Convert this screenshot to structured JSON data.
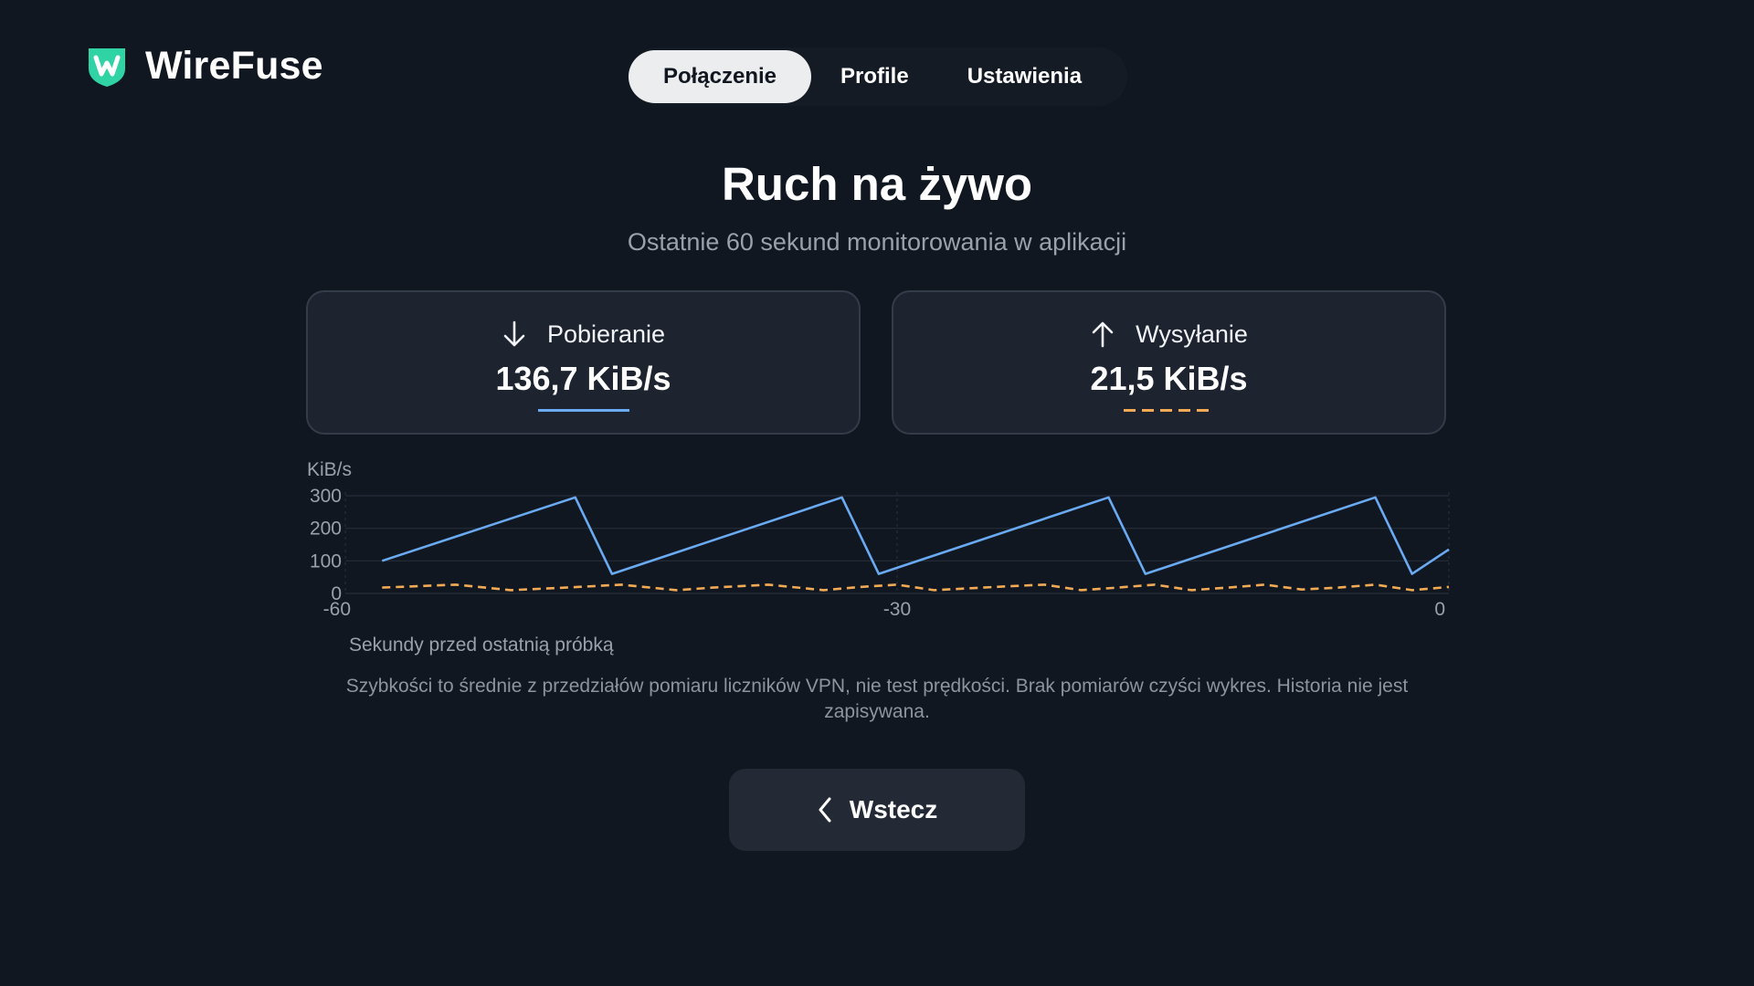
{
  "app": {
    "name": "WireFuse",
    "accent": "#2fd3a4"
  },
  "tabs": [
    {
      "label": "Połączenie",
      "active": true
    },
    {
      "label": "Profile",
      "active": false
    },
    {
      "label": "Ustawienia",
      "active": false
    }
  ],
  "page": {
    "title": "Ruch na żywo",
    "subtitle": "Ostatnie 60 sekund monitorowania w aplikacji"
  },
  "stats": {
    "download": {
      "label": "Pobieranie",
      "value": "136,7 KiB/s",
      "icon": "arrow-down-icon",
      "color": "#6aaaf2"
    },
    "upload": {
      "label": "Wysyłanie",
      "value": "21,5 KiB/s",
      "icon": "arrow-up-icon",
      "color": "#f2aa55"
    }
  },
  "chart_data": {
    "type": "line",
    "ylabel": "KiB/s",
    "xlabel": "Sekundy przed ostatnią próbką",
    "ylim": [
      0,
      300
    ],
    "xlim": [
      -60,
      0
    ],
    "y_ticks": [
      "300",
      "200",
      "100",
      "0"
    ],
    "x_ticks": [
      "-60",
      "-30",
      "0"
    ],
    "grid": true,
    "series": [
      {
        "style": "solid",
        "color": "#6aaaf2",
        "x": [
          -58,
          -47.5,
          -45.5,
          -33,
          -31,
          -18.5,
          -16.5,
          -4,
          -2,
          0
        ],
        "values": [
          100,
          295,
          60,
          295,
          60,
          295,
          60,
          295,
          60,
          135
        ]
      },
      {
        "style": "dashed",
        "color": "#f2aa55",
        "x": [
          -58,
          -54,
          -51,
          -48,
          -45,
          -42,
          -40,
          -37,
          -34,
          -32,
          -30,
          -28,
          -26,
          -24,
          -22,
          -20,
          -18,
          -16,
          -14,
          -12,
          -10,
          -8,
          -6,
          -4,
          -2,
          0
        ],
        "values": [
          18,
          27,
          10,
          18,
          27,
          10,
          18,
          27,
          10,
          20,
          27,
          10,
          16,
          22,
          27,
          10,
          18,
          27,
          10,
          18,
          27,
          12,
          18,
          27,
          10,
          20
        ]
      }
    ]
  },
  "note": "Szybkości to średnie z przedziałów pomiaru liczników VPN, nie test prędkości. Brak pomiarów czyści wykres. Historia nie jest zapisywana.",
  "back_button": {
    "label": "Wstecz"
  }
}
